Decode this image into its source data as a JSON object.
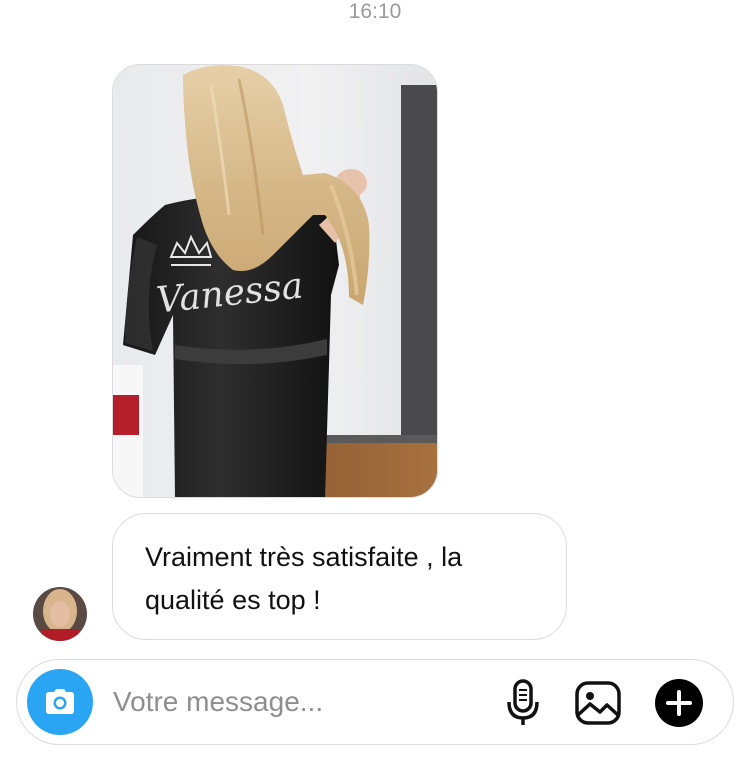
{
  "header": {
    "timestamp": "16:10"
  },
  "conversation": {
    "photo_message": {
      "embroidery_text": "Vanessa"
    },
    "text_message": {
      "text": "Vraiment très satisfaite , la qualité es top !"
    }
  },
  "composer": {
    "placeholder": "Votre message...",
    "value": ""
  },
  "icons": {
    "camera": "camera-icon",
    "microphone": "microphone-icon",
    "gallery": "image-gallery-icon",
    "more": "plus-circle-icon"
  },
  "colors": {
    "camera_button": "#2aa5f3",
    "bubble_border": "#dbdbdb",
    "timestamp": "#9a9a9a",
    "text": "#111111"
  }
}
